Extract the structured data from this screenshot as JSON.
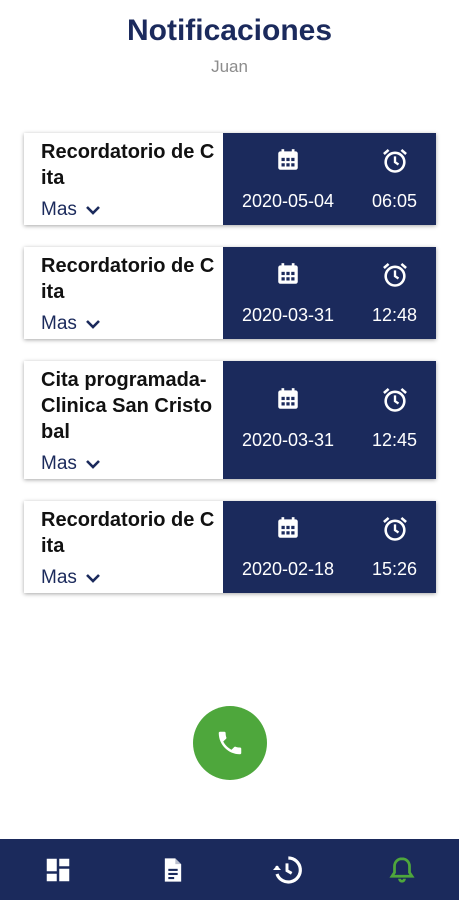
{
  "header": {
    "title": "Notificaciones",
    "user": "Juan"
  },
  "colors": {
    "primary": "#1b2a5c",
    "accent_green": "#4ea73c",
    "white": "#ffffff"
  },
  "notifications": [
    {
      "title": "Recordatorio de Cita",
      "more_label": "Mas",
      "date": "2020-05-04",
      "time": "06:05"
    },
    {
      "title": "Recordatorio de Cita",
      "more_label": "Mas",
      "date": "2020-03-31",
      "time": "12:48"
    },
    {
      "title": "Cita programada-Clinica San Cristobal",
      "more_label": "Mas",
      "date": "2020-03-31",
      "time": "12:45"
    },
    {
      "title": "Recordatorio de Cita",
      "more_label": "Mas",
      "date": "2020-02-18",
      "time": "15:26"
    }
  ],
  "fab": {
    "icon": "phone-icon"
  },
  "bottom_nav": [
    {
      "icon": "dashboard-icon",
      "active": false
    },
    {
      "icon": "document-icon",
      "active": false
    },
    {
      "icon": "history-icon",
      "active": false
    },
    {
      "icon": "bell-icon",
      "active": true
    }
  ]
}
